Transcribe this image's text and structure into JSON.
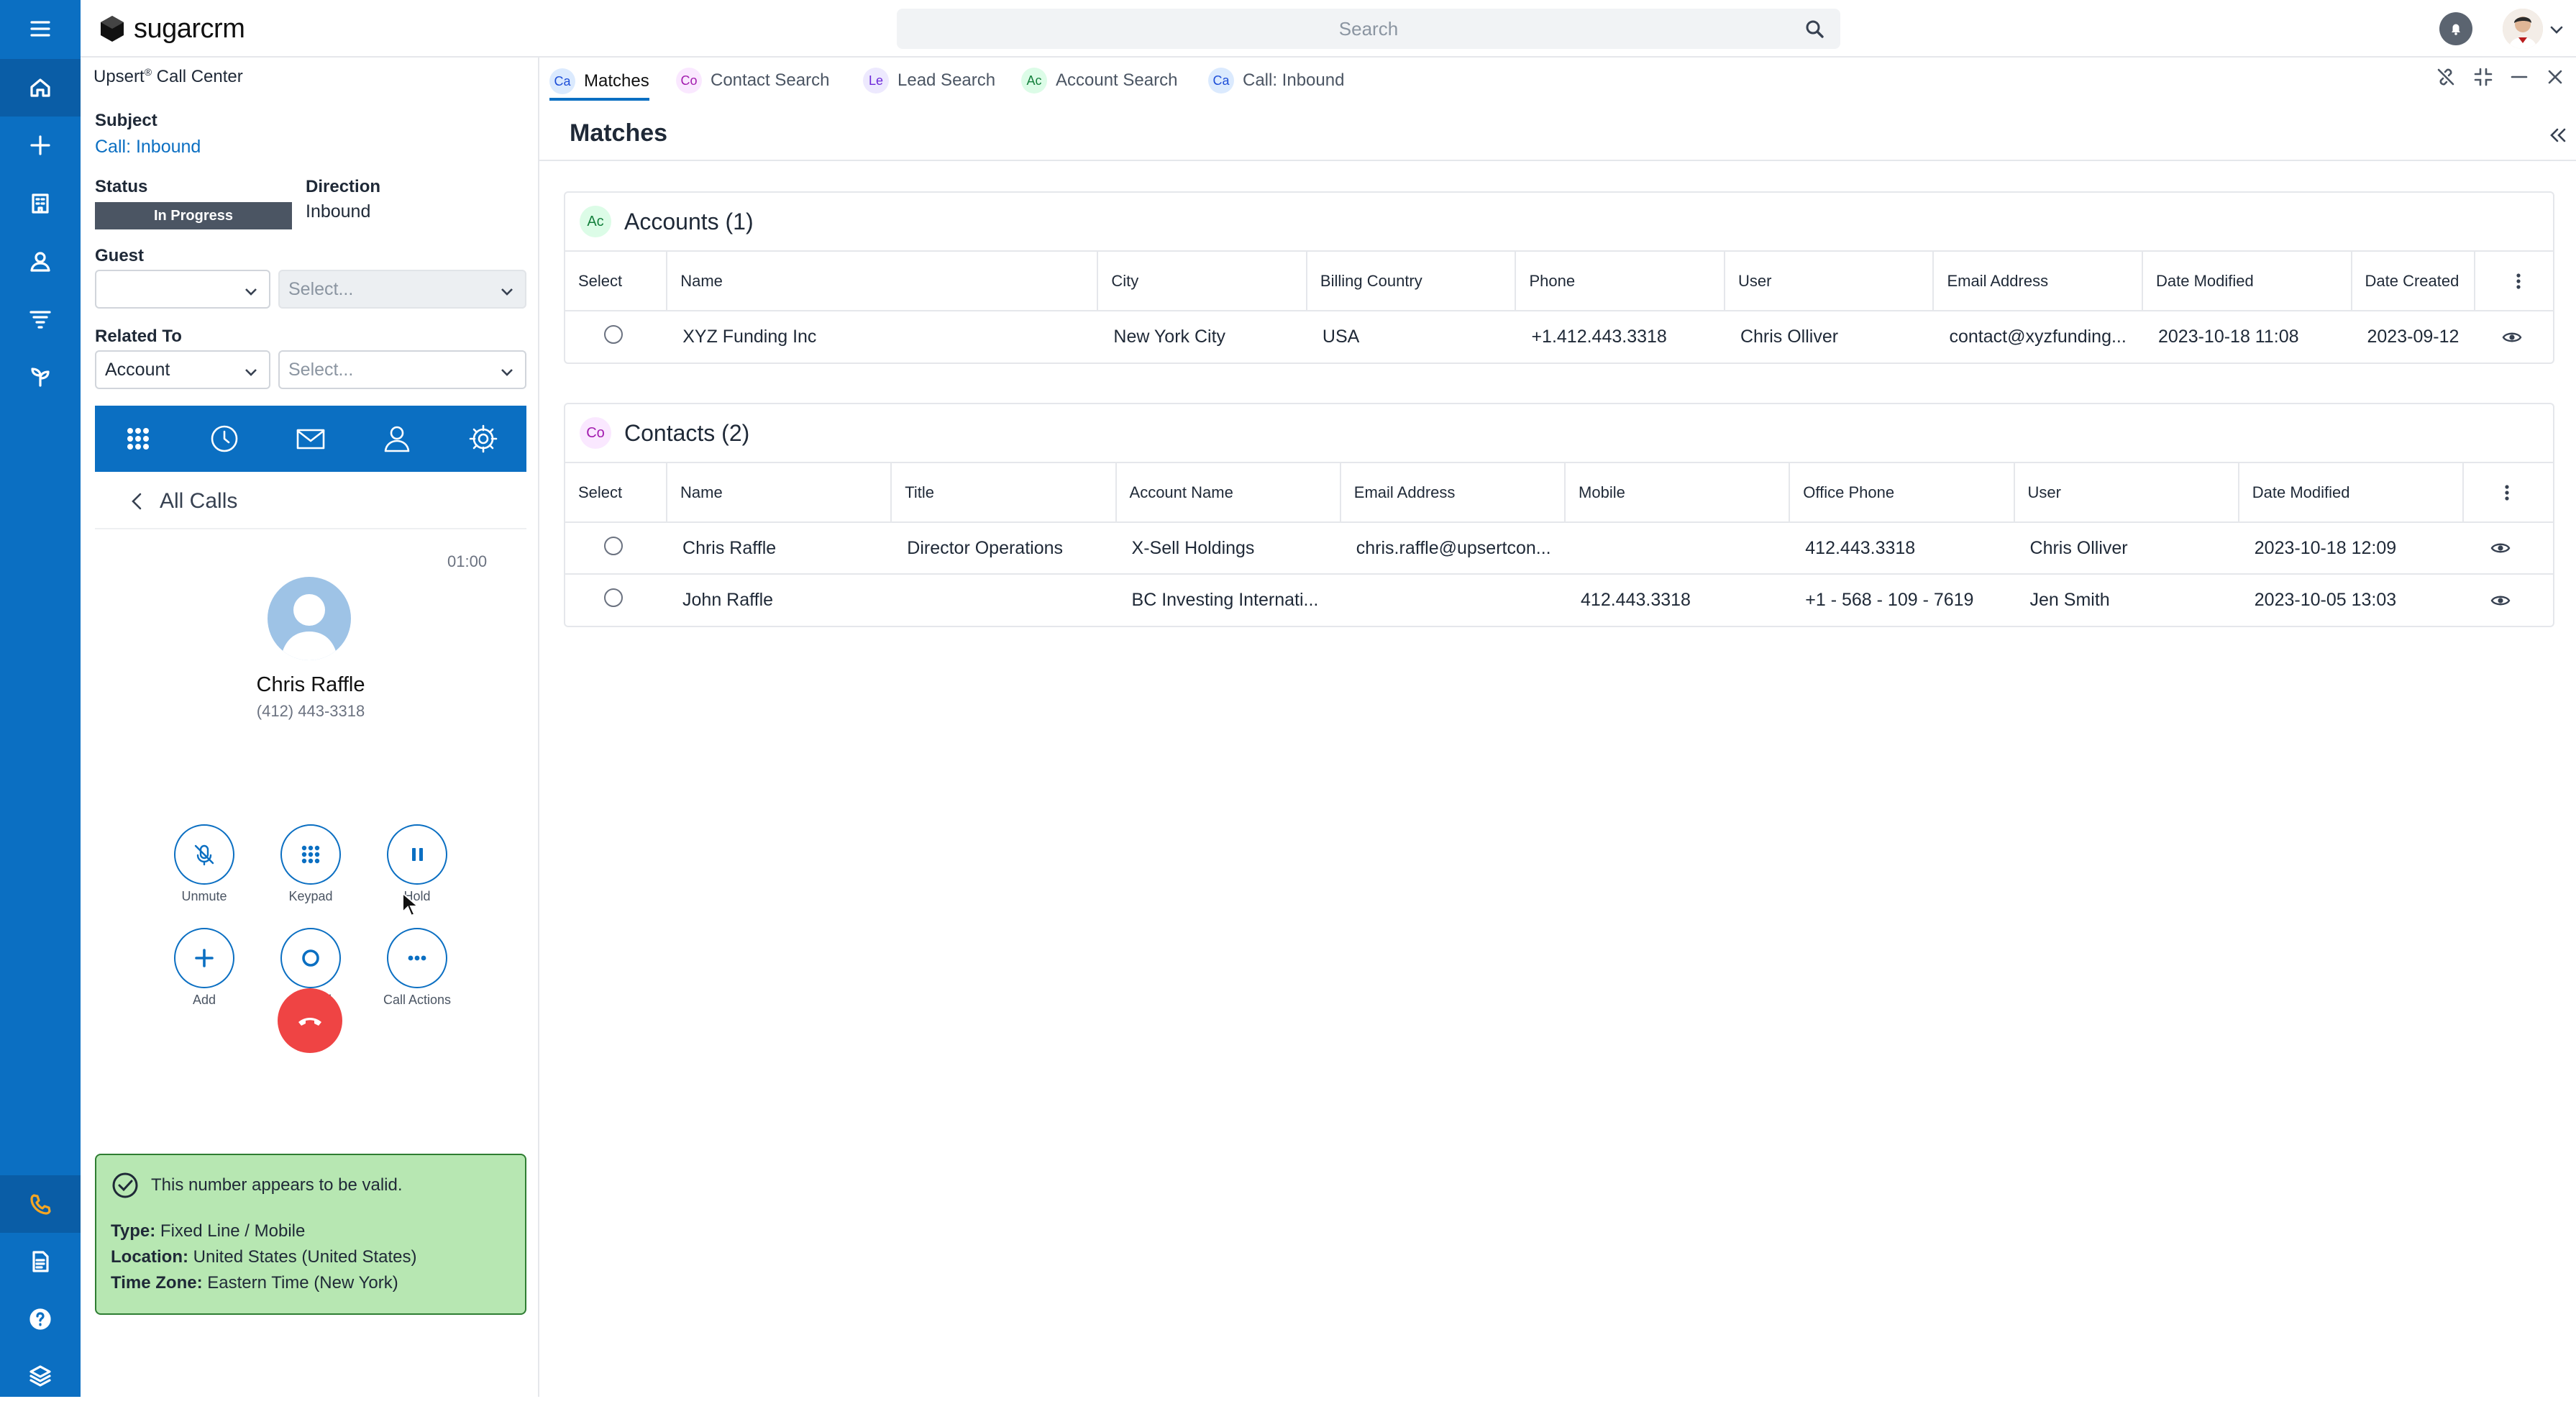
{
  "brand": {
    "logo_text": "sugarcrm",
    "accent": "#0b6fc2"
  },
  "header": {
    "search_placeholder": "Search"
  },
  "nav_rail": {
    "top_items": [
      "menu-icon",
      "home-icon",
      "plus-icon",
      "building-icon",
      "person-icon",
      "funnel-icon",
      "plant-icon"
    ],
    "bottom_items": [
      "phone-icon",
      "document-icon",
      "help-icon",
      "layers-icon"
    ]
  },
  "call_panel": {
    "title": "Upsert",
    "title_mark": "®",
    "title_suffix": " Call Center",
    "subject_label": "Subject",
    "subject_value": "Call: Inbound",
    "status_label": "Status",
    "status_value": "In Progress",
    "direction_label": "Direction",
    "direction_value": "Inbound",
    "guest_label": "Guest",
    "guest_type": "",
    "guest_select_placeholder": "Select...",
    "related_label": "Related To",
    "related_type": "Account",
    "related_select_placeholder": "Select...",
    "dialer_tabs": [
      "keypad-grid-icon",
      "clock-icon",
      "envelope-icon",
      "user-icon",
      "settings-icon"
    ],
    "all_calls_label": "All Calls",
    "timer": "01:00",
    "caller_name": "Chris Raffle",
    "caller_number": "(412) 443-3318",
    "buttons": {
      "unmute": "Unmute",
      "keypad": "Keypad",
      "hold": "Hold",
      "add": "Add",
      "record": "Record",
      "call_actions": "Call Actions"
    },
    "validation": {
      "headline": "This number appears to be valid.",
      "type_label": "Type:",
      "type_value": "Fixed Line / Mobile",
      "location_label": "Location:",
      "location_value": "United States (United States)",
      "timezone_label": "Time Zone:",
      "timezone_value": "Eastern Time (New York)"
    }
  },
  "tabs": [
    {
      "badge": "Ca",
      "label": "Matches",
      "active": true
    },
    {
      "badge": "Co",
      "label": "Contact Search",
      "active": false
    },
    {
      "badge": "Le",
      "label": "Lead Search",
      "active": false
    },
    {
      "badge": "Ac",
      "label": "Account Search",
      "active": false
    },
    {
      "badge": "Ca",
      "label": "Call: Inbound",
      "active": false
    }
  ],
  "matches": {
    "title": "Matches",
    "accounts": {
      "badge": "Ac",
      "title": "Accounts (1)",
      "columns": [
        "Select",
        "Name",
        "City",
        "Billing Country",
        "Phone",
        "User",
        "Email Address",
        "Date Modified",
        "Date Created"
      ],
      "rows": [
        [
          "",
          "XYZ Funding Inc",
          "New York City",
          "USA",
          "+1.412.443.3318",
          "Chris Olliver",
          "contact@xyzfunding...",
          "2023-10-18 11:08",
          "2023-09-12"
        ]
      ]
    },
    "contacts": {
      "badge": "Co",
      "title": "Contacts (2)",
      "columns": [
        "Select",
        "Name",
        "Title",
        "Account Name",
        "Email Address",
        "Mobile",
        "Office Phone",
        "User",
        "Date Modified"
      ],
      "rows": [
        [
          "",
          "Chris Raffle",
          "Director Operations",
          "X-Sell Holdings",
          "chris.raffle@upsertcon...",
          "",
          "412.443.3318",
          "Chris Olliver",
          "2023-10-18 12:09"
        ],
        [
          "",
          "John Raffle",
          "",
          "BC Investing Internati...",
          "",
          "412.443.3318",
          "+1 - 568 - 109 - 7619",
          "Jen Smith",
          "2023-10-05 13:03"
        ]
      ]
    }
  }
}
